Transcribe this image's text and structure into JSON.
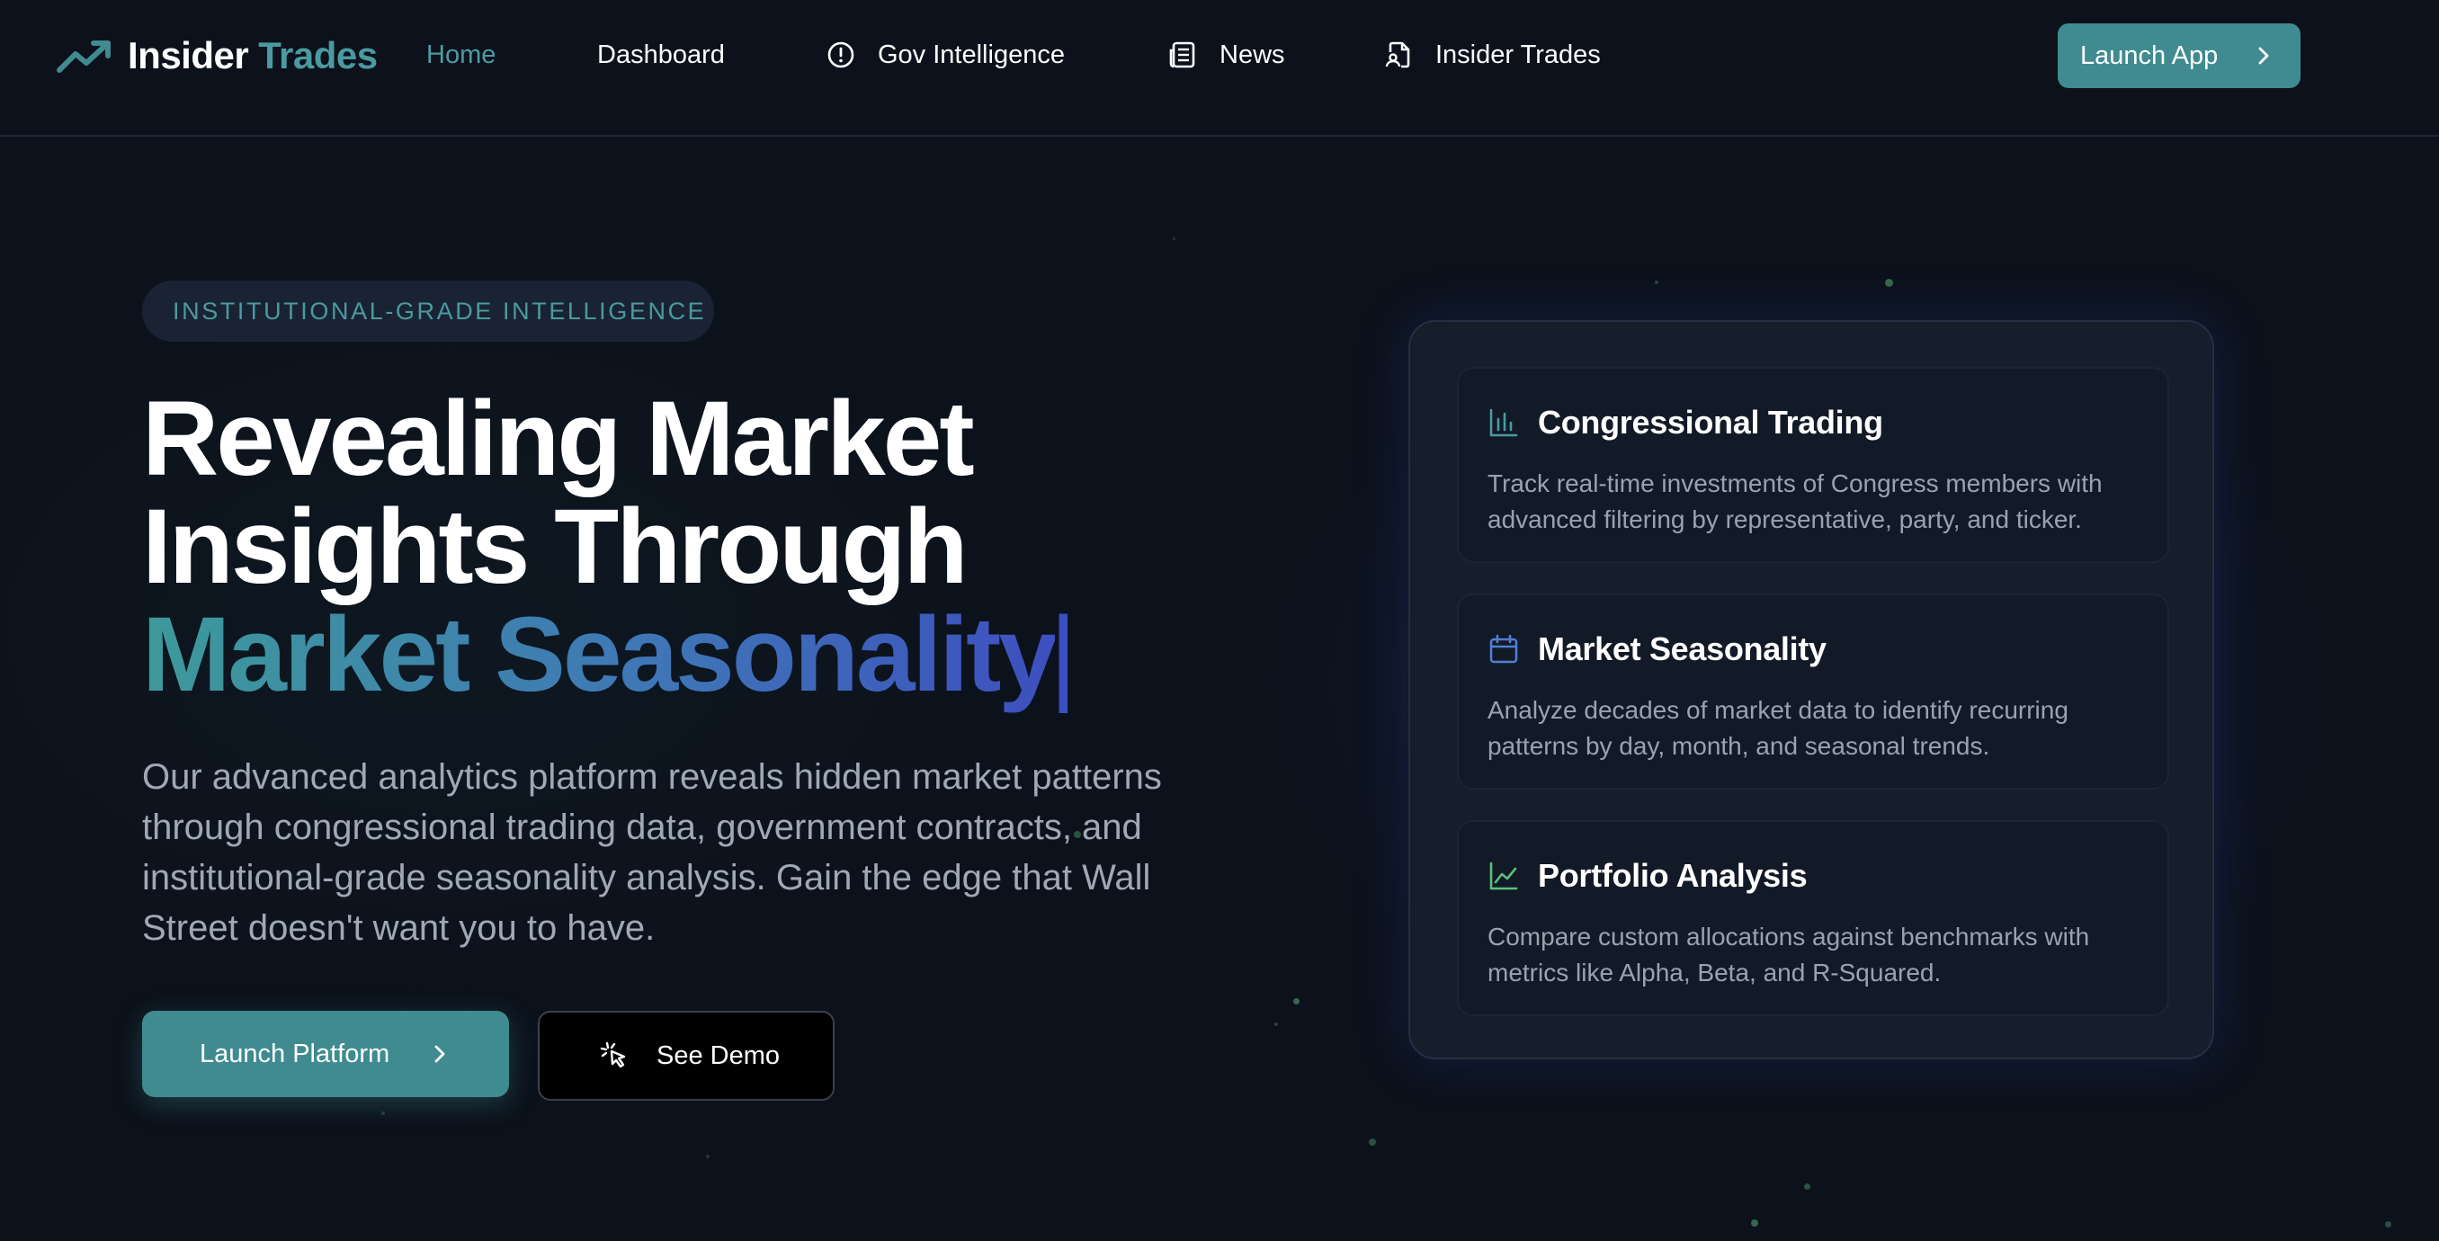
{
  "brand": {
    "name_part1": "Insider",
    "name_part2": "Trades",
    "logo_icon": "trending-up-icon"
  },
  "nav": {
    "items": [
      {
        "label": "Home",
        "icon": null,
        "active": true
      },
      {
        "label": "Dashboard",
        "icon": null,
        "active": false
      },
      {
        "label": "Gov Intelligence",
        "icon": "alert-circle-icon",
        "active": false
      },
      {
        "label": "News",
        "icon": "newspaper-icon",
        "active": false
      },
      {
        "label": "Insider Trades",
        "icon": "file-person-icon",
        "active": false
      }
    ],
    "launch_button": "Launch App"
  },
  "hero": {
    "badge": "INSTITUTIONAL-GRADE INTELLIGENCE",
    "headline_line1": "Revealing Market",
    "headline_line2": "Insights Through",
    "headline_line3": "Market Seasonality",
    "headline_cursor": "|",
    "subtext": "Our advanced analytics platform reveals hidden market patterns through congressional trading data, government contracts, and institutional-grade seasonality analysis. Gain the edge that Wall Street doesn't want you to have.",
    "primary_button": "Launch Platform",
    "secondary_button": "See Demo"
  },
  "features": [
    {
      "title": "Congressional Trading",
      "icon": "bar-chart-icon",
      "description": "Track real-time investments of Congress members with advanced filtering by representative, party, and ticker."
    },
    {
      "title": "Market Seasonality",
      "icon": "calendar-icon",
      "description": "Analyze decades of market data to identify recurring patterns by day, month, and seasonal trends."
    },
    {
      "title": "Portfolio Analysis",
      "icon": "line-chart-icon",
      "description": "Compare custom allocations against benchmarks with metrics like Alpha, Beta, and R-Squared."
    }
  ],
  "colors": {
    "background": "#0c111b",
    "accent_teal": "#3f8b90",
    "accent_blue": "#3e4fbf",
    "panel": "#161d2b"
  }
}
